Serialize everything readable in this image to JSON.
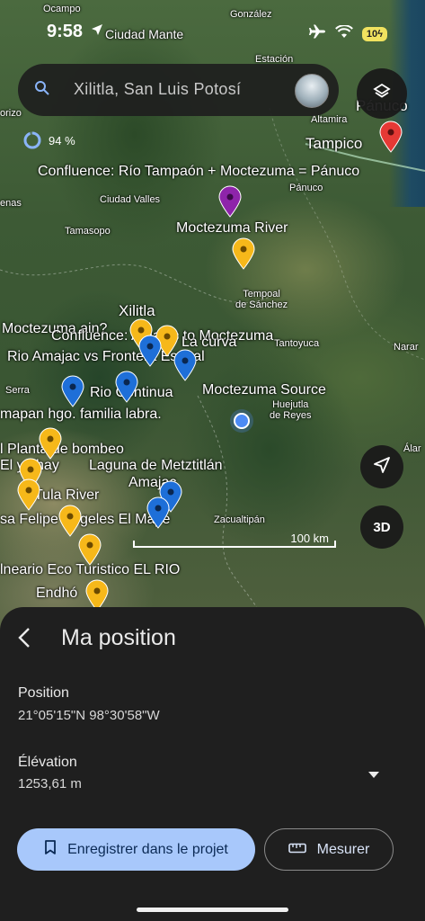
{
  "status": {
    "time": "9:58",
    "location_label": "Ciudad Mante",
    "battery": "10"
  },
  "search": {
    "placeholder": "Xilitla, San Luis Potosí"
  },
  "progress": {
    "value": "94 %",
    "fraction": 0.94
  },
  "map_labels": {
    "ocampo": "Ocampo",
    "gonzalez": "González",
    "estacion": "Estación",
    "panuco_top": "Pánuco",
    "altamira": "Altamira",
    "tampico": "Tampico",
    "panuco": "Pánuco",
    "ciudad_valles": "Ciudad Valles",
    "tamasopo": "Tamasopo",
    "tempoal": "Tempoal\nde Sánchez",
    "tantoyuca": "Tantoyuca",
    "huejutla": "Huejutla\nde Reyes",
    "zacualtipan": "Zacualtipán",
    "xilitla": "Xilitla",
    "naranjos": "Narar",
    "serra": "Serra",
    "orizo": "orizo",
    "enas": "enas",
    "alamo": "Álar"
  },
  "annotations": {
    "confluence_top": "Confluence: Río Tampaón + Moctezuma = Pánuco",
    "moctezuma_river": "Moctezuma River",
    "moctezuma_ain": "Moctezuma ain?",
    "confluence_amajac": "Confluence: Amajac to Moctezuma",
    "la_curva": "La curva",
    "rio_amajac": "Rio Amajac vs Frontera Estatal",
    "rio_continua": "Rio Continua",
    "moctezuma_source": "Moctezuma Source",
    "mapan": "mapan hgo. familia labra.",
    "planta": "l Planta de bombeo",
    "yethay": "El yethay",
    "laguna": "Laguna de Metztitlán",
    "amajac": "Amajac",
    "tula": "Tula River",
    "presa": "sa Felipe Ángeles El Maye",
    "balneario": "lneario Eco Turistico EL RIO",
    "endho": "Endhó"
  },
  "scale": {
    "label": "100 km"
  },
  "buttons": {
    "three_d": "3D"
  },
  "sheet": {
    "title": "Ma position",
    "position_label": "Position",
    "position_value": "21°05'15\"N 98°30'58\"W",
    "elevation_label": "Élévation",
    "elevation_value": "1253,61 m",
    "save_label": "Enregistrer dans le projet",
    "measure_label": "Mesurer"
  },
  "colors": {
    "pin_yellow": "#f6b81a",
    "pin_blue": "#1e6fd8",
    "pin_red": "#e53935",
    "pin_purple": "#8e24aa",
    "primary_button": "#a8c8fb",
    "sheet_bg": "#1f1f1f"
  }
}
